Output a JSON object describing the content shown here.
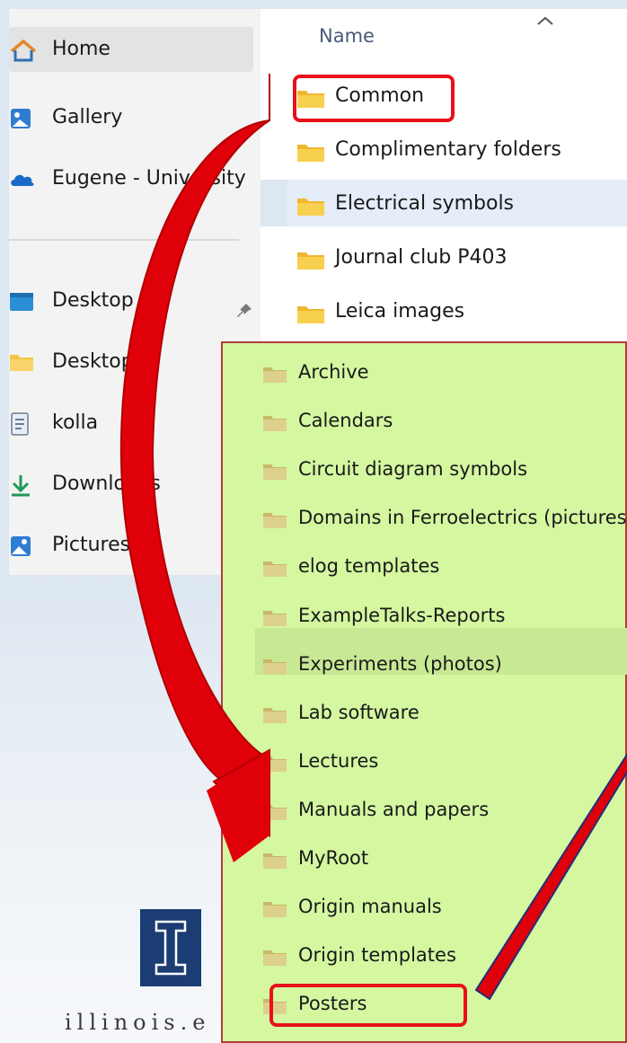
{
  "explorer": {
    "sidebar": {
      "items": [
        {
          "label": "Home",
          "icon": "home-icon"
        },
        {
          "label": "Gallery",
          "icon": "gallery-icon"
        },
        {
          "label": "Eugene - University",
          "icon": "onedrive-cloud-icon"
        },
        {
          "label": "Desktop",
          "icon": "desktop-icon",
          "pinned": true
        },
        {
          "label": "Desktop",
          "icon": "folder-icon"
        },
        {
          "label": "kolla",
          "icon": "document-icon"
        },
        {
          "label": "Downloads",
          "icon": "download-icon"
        },
        {
          "label": "Pictures",
          "icon": "pictures-icon"
        }
      ]
    },
    "file_list": {
      "column_header": "Name",
      "rows": [
        {
          "label": "Common"
        },
        {
          "label": "Complimentary folders"
        },
        {
          "label": "Electrical symbols"
        },
        {
          "label": "Journal club P403"
        },
        {
          "label": "Leica images"
        }
      ]
    }
  },
  "folder_listing": {
    "items": [
      "Archive",
      "Calendars",
      "Circuit diagram symbols",
      "Domains in Ferroelectrics (pictures)",
      "elog templates",
      "ExampleTalks-Reports",
      "Experiments (photos)",
      "Lab software",
      "Lectures",
      "Manuals and papers",
      "MyRoot",
      "Origin manuals",
      "Origin templates",
      "Posters"
    ]
  },
  "logo": {
    "text": "illinois.e"
  },
  "colors": {
    "accent_red": "#e8101a",
    "arrow_red": "#e0000a",
    "panel_green": "#d4f7a0",
    "folder_yellow": "#f4c542",
    "logo_blue": "#1b3d73"
  }
}
